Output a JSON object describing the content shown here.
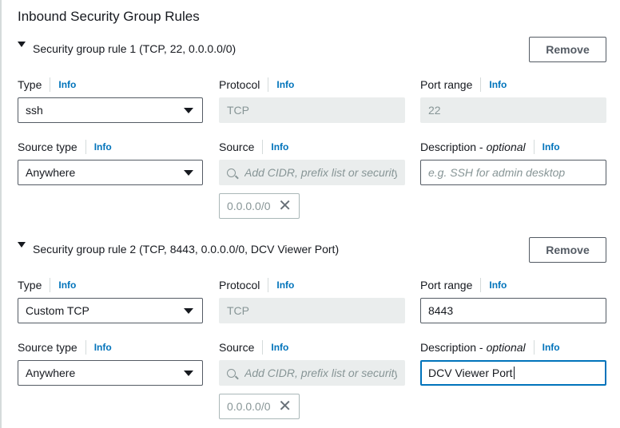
{
  "section": {
    "title": "Inbound Security Group Rules"
  },
  "labels": {
    "type": "Type",
    "protocol": "Protocol",
    "port_range": "Port range",
    "source_type": "Source type",
    "source": "Source",
    "description": "Description -",
    "optional": "optional",
    "info": "Info",
    "remove": "Remove"
  },
  "rules": [
    {
      "title": "Security group rule 1 (TCP, 22, 0.0.0.0/0)",
      "type_value": "ssh",
      "protocol_value": "TCP",
      "port_range_value": "22",
      "source_type_value": "Anywhere",
      "source_placeholder": "Add CIDR, prefix list or security",
      "source_token": "0.0.0.0/0",
      "description_value": "",
      "description_placeholder": "e.g. SSH for admin desktop"
    },
    {
      "title": "Security group rule 2 (TCP, 8443, 0.0.0.0/0, DCV Viewer Port)",
      "type_value": "Custom TCP",
      "protocol_value": "TCP",
      "port_range_value": "8443",
      "source_type_value": "Anywhere",
      "source_placeholder": "Add CIDR, prefix list or security",
      "source_token": "0.0.0.0/0",
      "description_value": "DCV Viewer Port",
      "description_placeholder": ""
    }
  ],
  "colors": {
    "link_info": "#0073bb",
    "focus_border": "#0073bb",
    "disabled_bg": "#eaeded"
  }
}
